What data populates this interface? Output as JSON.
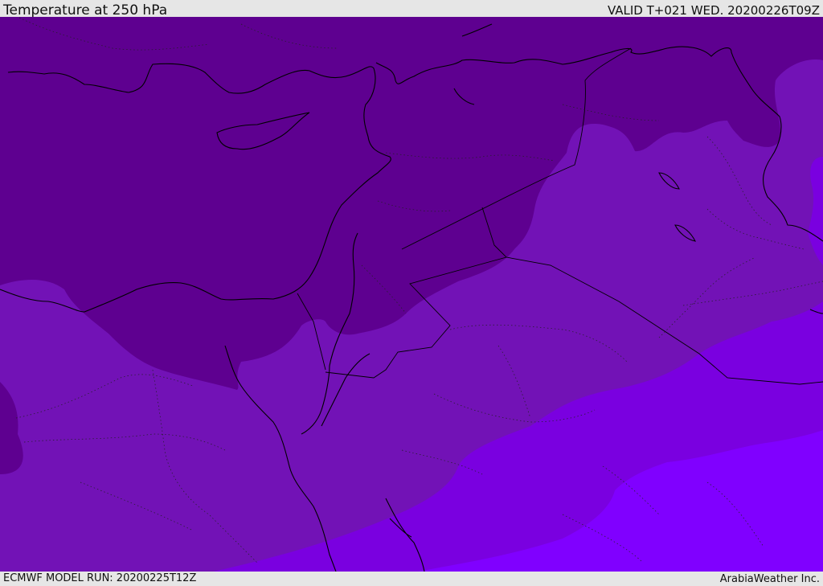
{
  "header": {
    "title": "Temperature at 250 hPa",
    "valid": "VALID T+021 WED. 20200226T09Z"
  },
  "footer": {
    "model_run": "ECMWF MODEL RUN: 20200225T12Z",
    "credit": "ArabiaWeather Inc."
  },
  "legend_colors": {
    "coldest": "#5e0090",
    "cold": "#7010b0",
    "mid": "#7a00e0",
    "warm": "#8000ff"
  }
}
